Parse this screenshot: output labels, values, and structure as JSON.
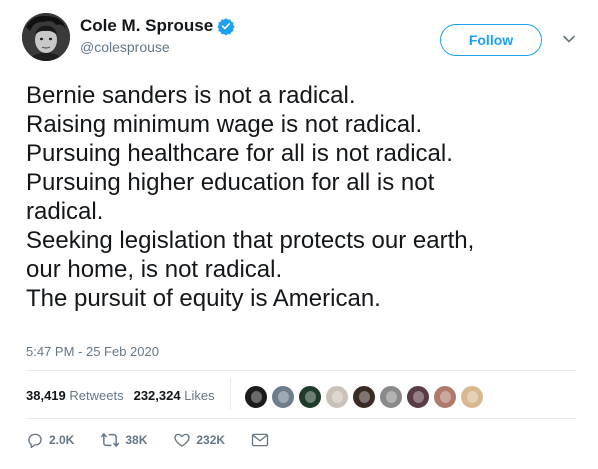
{
  "user": {
    "display_name": "Cole M. Sprouse",
    "handle": "@colesprouse",
    "verified": true
  },
  "follow_label": "Follow",
  "tweet_lines": [
    "Bernie sanders is not a radical.",
    "Raising minimum wage is not radical.",
    "Pursuing healthcare for all is not radical.",
    "Pursuing higher education for all is not",
    "radical.",
    "Seeking legislation that protects our earth,",
    "our home, is not radical.",
    "The pursuit of equity is American."
  ],
  "timestamp": "5:47 PM - 25 Feb 2020",
  "stats": {
    "retweets_count": "38,419",
    "retweets_label": "Retweets",
    "likes_count": "232,324",
    "likes_label": "Likes"
  },
  "likers": [
    {
      "name": "liker-avatar-1",
      "color": "#1b1b1b"
    },
    {
      "name": "liker-avatar-2",
      "color": "#6e7d8c"
    },
    {
      "name": "liker-avatar-3",
      "color": "#1f3a2a"
    },
    {
      "name": "liker-avatar-4",
      "color": "#c9c2b8"
    },
    {
      "name": "liker-avatar-5",
      "color": "#3a2a24"
    },
    {
      "name": "liker-avatar-6",
      "color": "#8a8a8a"
    },
    {
      "name": "liker-avatar-7",
      "color": "#5a3c46"
    },
    {
      "name": "liker-avatar-8",
      "color": "#b07a6a"
    },
    {
      "name": "liker-avatar-9",
      "color": "#d7b98f"
    }
  ],
  "actions": {
    "reply_count": "2.0K",
    "retweet_count": "38K",
    "like_count": "232K"
  },
  "colors": {
    "accent": "#1da1f2",
    "muted": "#657786",
    "text": "#14171a"
  },
  "icons": [
    "verified-badge-icon",
    "chevron-down-icon",
    "reply-icon",
    "retweet-icon",
    "heart-icon",
    "direct-message-icon"
  ]
}
